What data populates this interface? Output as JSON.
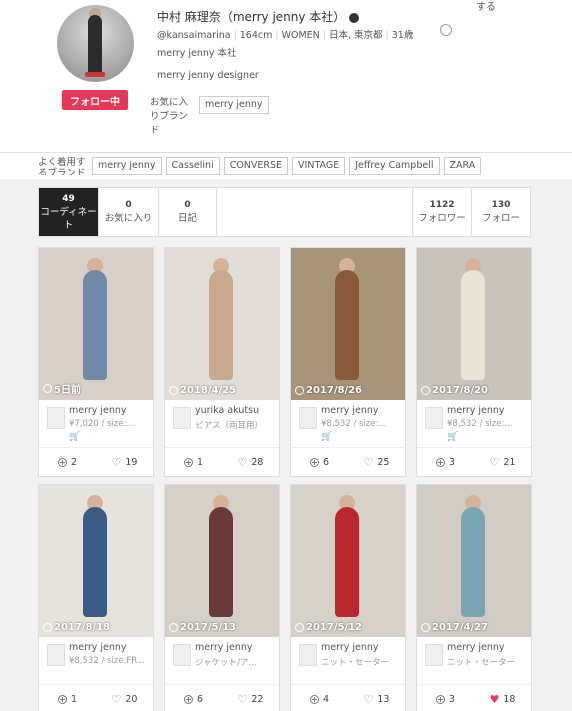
{
  "profile": {
    "name": "中村 麻理奈（merry jenny 本社）",
    "handle": "@kansaimarina",
    "height": "164cm",
    "gender": "WOMEN",
    "location": "日本, 東京都",
    "age": "31歳",
    "affiliation": "merry jenny 本社",
    "bio": "merry jenny designer",
    "follow_label": "フォロー中",
    "top_right_text": "する",
    "fav_brand_label": "お気に入りブランド",
    "fav_brand": "merry jenny"
  },
  "tagbar": {
    "label": "よく着用するブランド",
    "tags": [
      "merry jenny",
      "Casselini",
      "CONVERSE",
      "VINTAGE",
      "Jeffrey Campbell",
      "ZARA"
    ]
  },
  "stats": {
    "coordinates": {
      "num": "49",
      "label": "コーディネート"
    },
    "favorites": {
      "num": "0",
      "label": "お気に入り"
    },
    "diary": {
      "num": "0",
      "label": "日記"
    },
    "followers": {
      "num": "1122",
      "label": "フォロワー"
    },
    "following": {
      "num": "130",
      "label": "フォロー"
    }
  },
  "cards": [
    {
      "date": "5日前",
      "brand": "merry jenny",
      "detail": "¥7,020 / size:...",
      "cart": "🛒",
      "adds": "2",
      "likes": "19",
      "liked": false,
      "bg": "#d8d0c8",
      "outfit": "#6e8aa8"
    },
    {
      "date": "2018/4/25",
      "brand": "yurika akutsu",
      "detail": "ピアス（両耳用）",
      "cart": "",
      "adds": "1",
      "likes": "28",
      "liked": false,
      "bg": "#e2ddd6",
      "outfit": "#c7a98c"
    },
    {
      "date": "2017/8/26",
      "brand": "merry jenny",
      "detail": "¥8,532 / size:...",
      "cart": "🛒",
      "adds": "6",
      "likes": "25",
      "liked": false,
      "bg": "#a89478",
      "outfit": "#8a5a3c"
    },
    {
      "date": "2017/8/20",
      "brand": "merry jenny",
      "detail": "¥8,532 / size:...",
      "cart": "🛒",
      "adds": "3",
      "likes": "21",
      "liked": false,
      "bg": "#c9c4bb",
      "outfit": "#e9e4d6"
    },
    {
      "date": "2017/8/18",
      "brand": "merry jenny",
      "detail": "¥8,532 / size:FR...",
      "cart": "",
      "adds": "1",
      "likes": "20",
      "liked": false,
      "bg": "#e6e2dc",
      "outfit": "#3b5a86"
    },
    {
      "date": "2017/5/13",
      "brand": "merry jenny",
      "detail": "ジャケット/ア...",
      "cart": "",
      "adds": "6",
      "likes": "22",
      "liked": false,
      "bg": "#d4d0c8",
      "outfit": "#6a3a3a"
    },
    {
      "date": "2017/5/12",
      "brand": "merry jenny",
      "detail": "ニット・セーター",
      "cart": "",
      "adds": "4",
      "likes": "13",
      "liked": false,
      "bg": "#d6d2ca",
      "outfit": "#b8282e"
    },
    {
      "date": "2017/4/27",
      "brand": "merry jenny",
      "detail": "ニット・セーター",
      "cart": "",
      "adds": "3",
      "likes": "18",
      "liked": true,
      "bg": "#d1ccc3",
      "outfit": "#7aa6b4"
    }
  ]
}
